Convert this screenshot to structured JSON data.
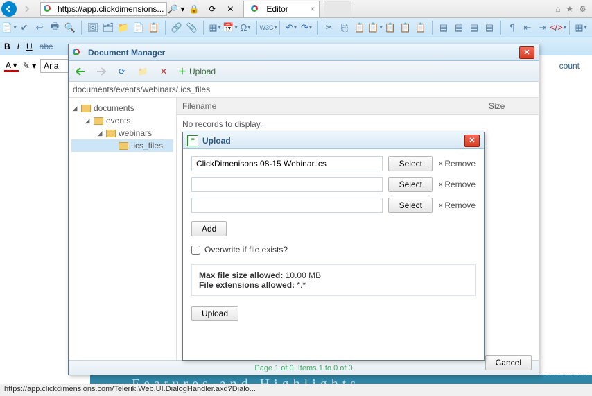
{
  "browser": {
    "url": "https://app.clickdimensions...",
    "search_hint": "🔎 ▾",
    "refresh_hint": "⟳",
    "stop_hint": "✕",
    "tab_title": "Editor",
    "home_icon": "⌂",
    "star_icon": "★",
    "gear_icon": "⚙"
  },
  "format": {
    "bold": "B",
    "italic": "I",
    "underline": "U",
    "strike": "abc",
    "a_label": "A",
    "font_name": "Aria"
  },
  "account_link": "count",
  "doc_mgr": {
    "title": "Document Manager",
    "upload_btn": "Upload",
    "path": "documents/events/webinars/.ics_files",
    "tree": {
      "root": "documents",
      "l2": "events",
      "l3": "webinars",
      "l4": ".ics_files"
    },
    "cols": {
      "filename": "Filename",
      "size": "Size"
    },
    "empty": "No records to display.",
    "pager": "Page 1 of 0. Items 1 to 0 of 0",
    "cancel": "Cancel"
  },
  "upload": {
    "title": "Upload",
    "rows": [
      {
        "value": "ClickDimenisons 08-15 Webinar.ics"
      },
      {
        "value": ""
      },
      {
        "value": ""
      }
    ],
    "select": "Select",
    "remove": "Remove",
    "add": "Add",
    "overwrite": "Overwrite if file exists?",
    "max_label": "Max file size allowed:",
    "max_value": "10.00 MB",
    "ext_label": "File extensions allowed:",
    "ext_value": "*.*",
    "go": "Upload"
  },
  "status_bar": "https://app.clickdimensions.com/Telerik.Web.UI.DialogHandler.axd?Dialo...",
  "banner_text": "Features and Highlights"
}
